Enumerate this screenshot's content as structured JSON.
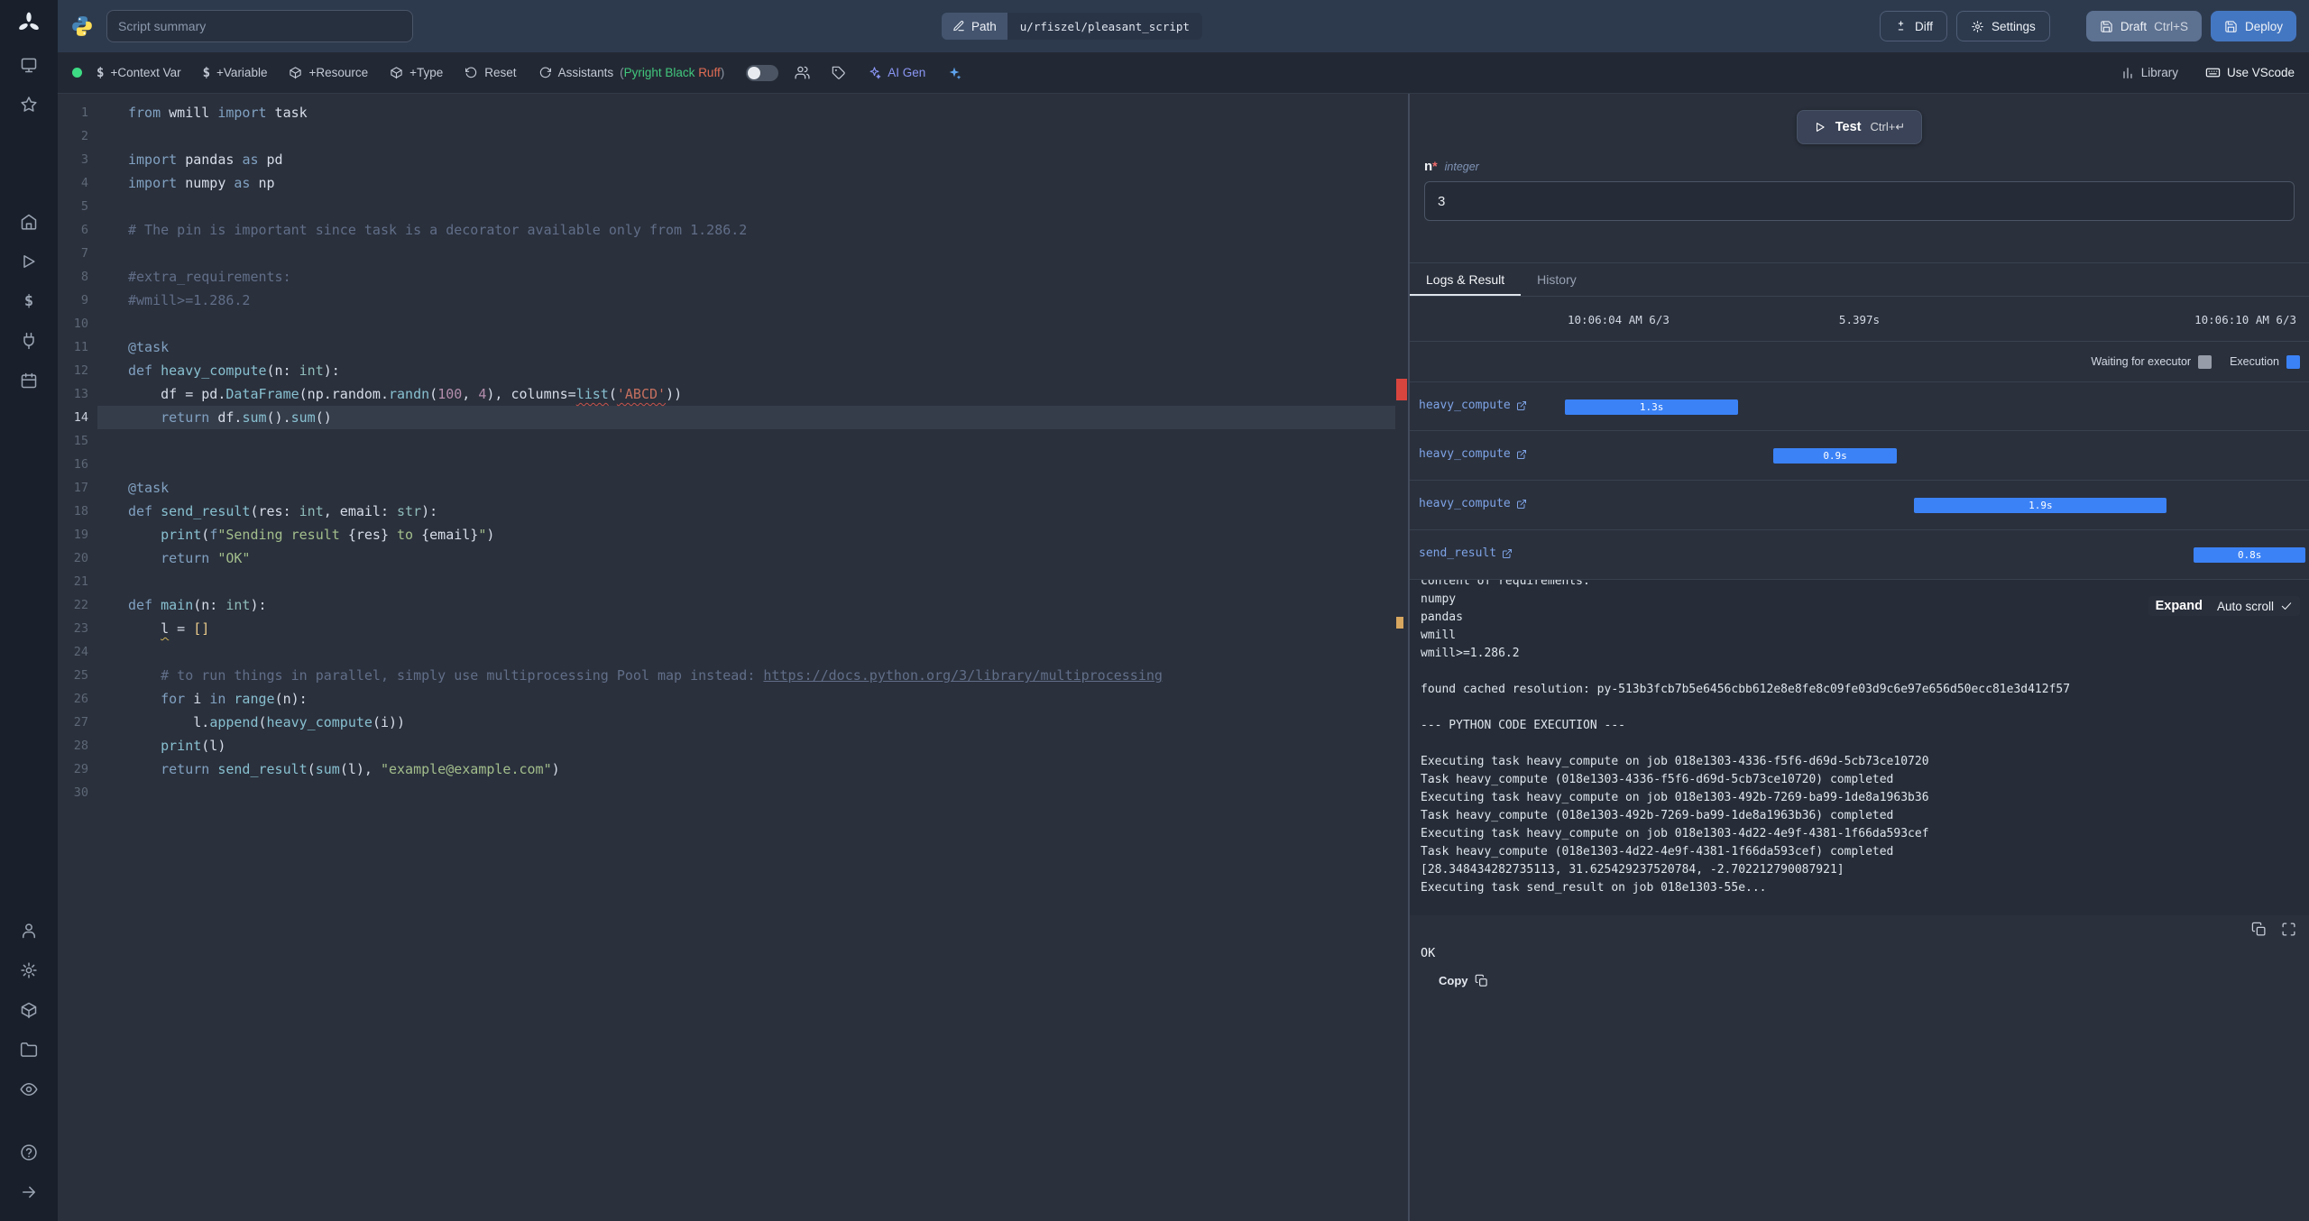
{
  "colors": {
    "accent_blue": "#3b82f6",
    "waiting_gray": "#969ca8",
    "error_red": "#d8453f",
    "warning_yellow": "#d7a65f",
    "status_green": "#3ddc84"
  },
  "sidebar": {
    "icons": [
      "windmill-logo",
      "apps",
      "favorites",
      "home",
      "runs",
      "variables",
      "resources",
      "schedules",
      "user",
      "settings",
      "workers",
      "folders",
      "audit-logs",
      "help",
      "collapse"
    ]
  },
  "topbar": {
    "summary_placeholder": "Script summary",
    "path_label": "Path",
    "path_value": "u/rfiszel/pleasant_script",
    "diff_label": "Diff",
    "settings_label": "Settings",
    "draft_label": "Draft",
    "draft_shortcut": "Ctrl+S",
    "deploy_label": "Deploy"
  },
  "toolbar": {
    "context_var_label": "+Context Var",
    "variable_label": "+Variable",
    "resource_label": "+Resource",
    "type_label": "+Type",
    "reset_label": "Reset",
    "assistants_label": "Assistants",
    "assistant_open_paren": "(",
    "assistant_pyright": "Pyright",
    "assistant_black": "Black",
    "assistant_ruff": "Ruff",
    "assistant_close_paren": ")",
    "ai_gen_label": "AI Gen",
    "library_label": "Library",
    "use_vscode_label": "Use VScode"
  },
  "editor": {
    "active_line": 14,
    "markers": [
      {
        "line": 13,
        "type": "error"
      },
      {
        "line": 23,
        "type": "warning"
      }
    ],
    "lines": [
      {
        "n": 1,
        "s": [
          [
            "from",
            "k"
          ],
          [
            " wmill "
          ],
          [
            "import",
            "k"
          ],
          [
            " task"
          ]
        ]
      },
      {
        "n": 2,
        "s": []
      },
      {
        "n": 3,
        "s": [
          [
            "import",
            "k"
          ],
          [
            " pandas "
          ],
          [
            "as",
            "k"
          ],
          [
            " pd"
          ]
        ]
      },
      {
        "n": 4,
        "s": [
          [
            "import",
            "k"
          ],
          [
            " numpy "
          ],
          [
            "as",
            "k"
          ],
          [
            " np"
          ]
        ]
      },
      {
        "n": 5,
        "s": []
      },
      {
        "n": 6,
        "s": [
          [
            "# The pin is important since task is a decorator available only from 1.286.2",
            "c"
          ]
        ]
      },
      {
        "n": 7,
        "s": []
      },
      {
        "n": 8,
        "s": [
          [
            "#extra_requirements:",
            "c"
          ]
        ]
      },
      {
        "n": 9,
        "s": [
          [
            "#wmill>=1.286.2",
            "c"
          ]
        ]
      },
      {
        "n": 10,
        "s": []
      },
      {
        "n": 11,
        "s": [
          [
            "@task",
            "k"
          ]
        ]
      },
      {
        "n": 12,
        "s": [
          [
            "def",
            "k"
          ],
          [
            " "
          ],
          [
            "heavy_compute",
            "f"
          ],
          [
            "(n: "
          ],
          [
            "int",
            "t"
          ],
          [
            "):"
          ]
        ]
      },
      {
        "n": 13,
        "s": [
          [
            "    df = pd."
          ],
          [
            "DataFrame",
            "f"
          ],
          [
            "(np.random."
          ],
          [
            "randn",
            "f"
          ],
          [
            "("
          ],
          [
            "100",
            "n"
          ],
          [
            ", "
          ],
          [
            "4",
            "n"
          ],
          [
            "), columns="
          ],
          [
            "list",
            "fe"
          ],
          [
            "("
          ],
          [
            "'ABCD'",
            "se"
          ],
          [
            "))"
          ]
        ]
      },
      {
        "n": 14,
        "s": [
          [
            "    "
          ],
          [
            "return",
            "k"
          ],
          [
            " df."
          ],
          [
            "sum",
            "f"
          ],
          [
            "()."
          ],
          [
            "sum",
            "f"
          ],
          [
            "()"
          ]
        ]
      },
      {
        "n": 15,
        "s": []
      },
      {
        "n": 16,
        "s": []
      },
      {
        "n": 17,
        "s": [
          [
            "@task",
            "k"
          ]
        ]
      },
      {
        "n": 18,
        "s": [
          [
            "def",
            "k"
          ],
          [
            " "
          ],
          [
            "send_result",
            "f"
          ],
          [
            "(res: "
          ],
          [
            "int",
            "t"
          ],
          [
            ", email: "
          ],
          [
            "str",
            "t"
          ],
          [
            "):"
          ]
        ]
      },
      {
        "n": 19,
        "s": [
          [
            "    "
          ],
          [
            "print",
            "f"
          ],
          [
            "("
          ],
          [
            "f",
            "k"
          ],
          [
            "\"Sending result ",
            "s"
          ],
          [
            "{res}",
            "b"
          ],
          [
            " to ",
            "s"
          ],
          [
            "{email}",
            "b"
          ],
          [
            "\"",
            "s"
          ],
          [
            ")"
          ]
        ]
      },
      {
        "n": 20,
        "s": [
          [
            "    "
          ],
          [
            "return",
            "k"
          ],
          [
            " "
          ],
          [
            "\"OK\"",
            "s"
          ]
        ]
      },
      {
        "n": 21,
        "s": []
      },
      {
        "n": 22,
        "s": [
          [
            "def",
            "k"
          ],
          [
            " "
          ],
          [
            "main",
            "f"
          ],
          [
            "(n: "
          ],
          [
            "int",
            "t"
          ],
          [
            "):"
          ]
        ]
      },
      {
        "n": 23,
        "s": [
          [
            "    "
          ],
          [
            "l",
            "w"
          ],
          [
            " = "
          ],
          [
            "[]",
            "g"
          ]
        ]
      },
      {
        "n": 24,
        "s": []
      },
      {
        "n": 25,
        "s": [
          [
            "    # to run things in parallel, simply use multiprocessing Pool map instead: ",
            "c"
          ],
          [
            "https://docs.python.org/3/library/multiprocessing",
            "cu"
          ]
        ]
      },
      {
        "n": 26,
        "s": [
          [
            "    "
          ],
          [
            "for",
            "k"
          ],
          [
            " i "
          ],
          [
            "in",
            "k"
          ],
          [
            " "
          ],
          [
            "range",
            "f"
          ],
          [
            "(n):"
          ]
        ]
      },
      {
        "n": 27,
        "s": [
          [
            "        l."
          ],
          [
            "append",
            "f"
          ],
          [
            "("
          ],
          [
            "heavy_compute",
            "f"
          ],
          [
            "(i))"
          ]
        ]
      },
      {
        "n": 28,
        "s": [
          [
            "    "
          ],
          [
            "print",
            "f"
          ],
          [
            "(l)"
          ]
        ]
      },
      {
        "n": 29,
        "s": [
          [
            "    "
          ],
          [
            "return",
            "k"
          ],
          [
            " "
          ],
          [
            "send_result",
            "f"
          ],
          [
            "("
          ],
          [
            "sum",
            "f"
          ],
          [
            "(l), "
          ],
          [
            "\"example@example.com\"",
            "s"
          ],
          [
            ")"
          ]
        ]
      },
      {
        "n": 30,
        "s": []
      }
    ]
  },
  "panel": {
    "test_label": "Test",
    "test_shortcut": "Ctrl+↵",
    "arg": {
      "name": "n",
      "required_mark": "*",
      "type": "integer",
      "value": "3"
    },
    "tabs": [
      {
        "label": "Logs & Result"
      },
      {
        "label": "History"
      }
    ],
    "run": {
      "start_time": "10:06:04 AM 6/3",
      "duration": "5.397s",
      "end_time": "10:06:10 AM 6/3"
    },
    "legend": [
      {
        "label": "Waiting for executor",
        "color": "#969ca8"
      },
      {
        "label": "Execution",
        "color": "#3b82f6"
      }
    ],
    "gantt": [
      {
        "task": "heavy_compute",
        "duration": "1.3s",
        "left_pct": 17.3,
        "width_pct": 19.2
      },
      {
        "task": "heavy_compute",
        "duration": "0.9s",
        "left_pct": 40.4,
        "width_pct": 13.8
      },
      {
        "task": "heavy_compute",
        "duration": "1.9s",
        "left_pct": 56.1,
        "width_pct": 28.1
      },
      {
        "task": "send_result",
        "duration": "0.8s",
        "left_pct": 87.2,
        "width_pct": 12.4
      }
    ],
    "expand_label": "Expand",
    "autoscroll_label": "Auto scroll",
    "logs": [
      "content of requirements:",
      "numpy",
      "pandas",
      "wmill",
      "wmill>=1.286.2",
      "",
      "found cached resolution: py-513b3fcb7b5e6456cbb612e8e8fe8c09fe03d9c6e97e656d50ecc81e3d412f57",
      "",
      "--- PYTHON CODE EXECUTION ---",
      "",
      "Executing task heavy_compute on job 018e1303-4336-f5f6-d69d-5cb73ce10720",
      "Task heavy_compute (018e1303-4336-f5f6-d69d-5cb73ce10720) completed",
      "Executing task heavy_compute on job 018e1303-492b-7269-ba99-1de8a1963b36",
      "Task heavy_compute (018e1303-492b-7269-ba99-1de8a1963b36) completed",
      "Executing task heavy_compute on job 018e1303-4d22-4e9f-4381-1f66da593cef",
      "Task heavy_compute (018e1303-4d22-4e9f-4381-1f66da593cef) completed",
      "[28.348434282735113, 31.625429237520784, -2.702212790087921]",
      "Executing task send_result on job 018e1303-55e..."
    ],
    "result_value": "OK",
    "copy_label": "Copy"
  }
}
